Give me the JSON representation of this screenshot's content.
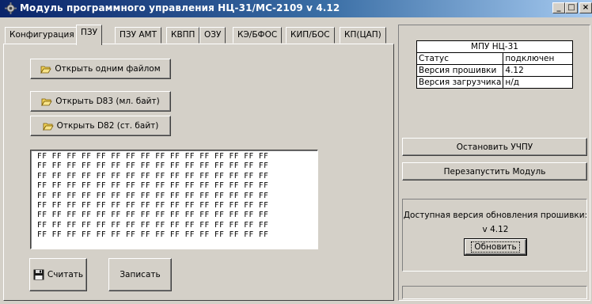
{
  "window": {
    "title": "Модуль программного управления НЦ-31/МС-2109 v 4.12",
    "controls": {
      "minimize": "_",
      "maximize": "□",
      "close": "×"
    }
  },
  "tabs": [
    {
      "label": "Конфигурация",
      "active": false
    },
    {
      "label": "ПЗУ",
      "active": true
    },
    {
      "label": "ПЗУ АМТ",
      "active": false
    },
    {
      "label": "КВПП",
      "active": false
    },
    {
      "label": "ОЗУ",
      "active": false
    },
    {
      "label": "КЭ/БФОС",
      "active": false
    },
    {
      "label": "КИП/БОС",
      "active": false
    },
    {
      "label": "КП(ЦАП)",
      "active": false
    }
  ],
  "rom": {
    "open_single_label": "Открыть одним файлом",
    "open_d83_label": "Открыть D83 (мл. байт)",
    "open_d82_label": "Открыть D82 (ст. байт)",
    "hex_rows": [
      "FF FF FF FF FF FF FF FF FF FF FF FF FF FF FF FF",
      "FF FF FF FF FF FF FF FF FF FF FF FF FF FF FF FF",
      "FF FF FF FF FF FF FF FF FF FF FF FF FF FF FF FF",
      "FF FF FF FF FF FF FF FF FF FF FF FF FF FF FF FF",
      "FF FF FF FF FF FF FF FF FF FF FF FF FF FF FF FF",
      "FF FF FF FF FF FF FF FF FF FF FF FF FF FF FF FF",
      "FF FF FF FF FF FF FF FF FF FF FF FF FF FF FF FF",
      "FF FF FF FF FF FF FF FF FF FF FF FF FF FF FF FF",
      "FF FF FF FF FF FF FF FF FF FF FF FF FF FF FF FF"
    ],
    "read_label": "Считать",
    "write_label": "Записать"
  },
  "info": {
    "header": "МПУ НЦ-31",
    "rows": [
      {
        "key": "Статус",
        "value": "подключен"
      },
      {
        "key": "Версия прошивки",
        "value": "4.12"
      },
      {
        "key": "Версия загрузчика",
        "value": "н/д"
      }
    ]
  },
  "actions": {
    "stop_label": "Остановить УЧПУ",
    "restart_label": "Перезапустить Модуль"
  },
  "update": {
    "available_text": "Доступная версия обновления прошивки:",
    "version": "v 4.12",
    "button_label": "Обновить"
  },
  "status": {
    "text": ""
  },
  "colors": {
    "title_bar_start": "#0a246a",
    "title_bar_end": "#a6caf0",
    "face": "#d4d0c8",
    "folder": "#f2d35a"
  },
  "icons": {
    "app": "gear-icon",
    "open": "folder-open-icon",
    "read": "floppy-disk-icon"
  }
}
